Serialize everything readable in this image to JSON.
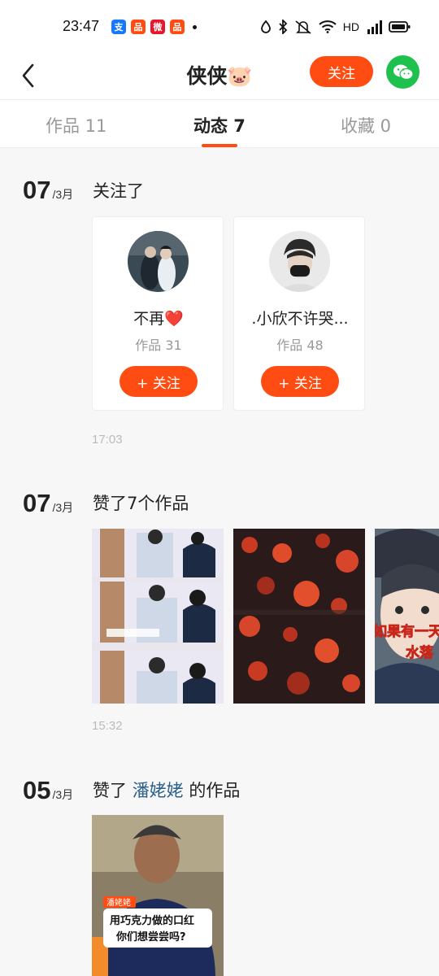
{
  "status_bar": {
    "time": "23:47",
    "network_label": "HD",
    "app_icons": [
      "alipay-icon",
      "app-icon",
      "weibo-icon",
      "app-icon"
    ]
  },
  "nav": {
    "title": "侠侠🐷",
    "follow_label": "关注",
    "back_icon": "chevron-left-icon",
    "wechat_icon": "wechat-icon"
  },
  "tabs": [
    {
      "label": "作品 11",
      "active": false
    },
    {
      "label": "动态 7",
      "active": true
    },
    {
      "label": "收藏 0",
      "active": false
    }
  ],
  "colors": {
    "accent": "#fe4c12",
    "wechat": "#1ec04e",
    "link": "#2c5f8c"
  },
  "feed": [
    {
      "day": "07",
      "month": "/3月",
      "title": "关注了",
      "time": "17:03",
      "users": [
        {
          "name": "不再❤️",
          "works": "作品 31",
          "follow_label": "+ 关注"
        },
        {
          "name": ".小欣不许哭...",
          "works": "作品 48",
          "follow_label": "+ 关注"
        }
      ]
    },
    {
      "day": "07",
      "month": "/3月",
      "title": "赞了7个作品",
      "time": "15:32",
      "thumb3_caption_1": "如果有一天",
      "thumb3_caption_2": "水落"
    },
    {
      "day": "05",
      "month": "/3月",
      "title_prefix": "赞了 ",
      "title_link": "潘姥姥",
      "title_suffix": " 的作品",
      "thumb_tag": "潘姥姥",
      "thumb_caption_1": "用巧克力做的口红",
      "thumb_caption_2": "你们想尝尝吗?"
    }
  ]
}
